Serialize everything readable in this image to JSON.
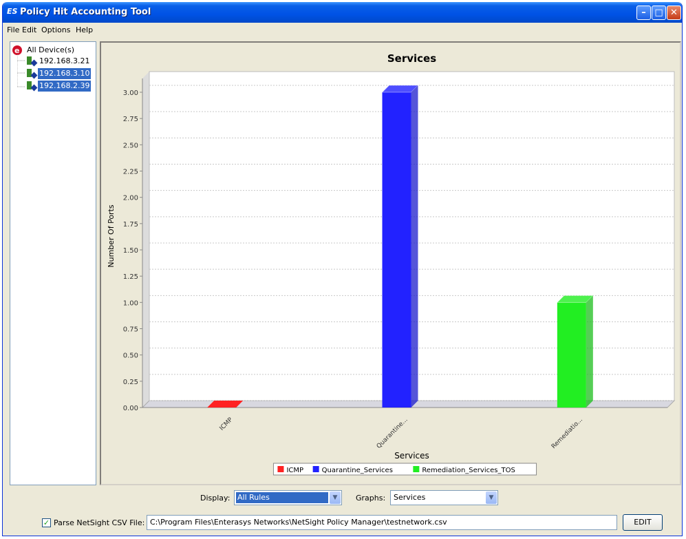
{
  "window": {
    "title": "Policy Hit Accounting Tool",
    "logo": "ES"
  },
  "menu": [
    "File",
    "Edit",
    "Options",
    "Help"
  ],
  "tree": {
    "root": "All Device(s)",
    "devices": [
      {
        "label": "192.168.3.21",
        "selected": false
      },
      {
        "label": "192.168.3.10",
        "selected": true
      },
      {
        "label": "192.168.2.39",
        "selected": true
      }
    ]
  },
  "chart_data": {
    "type": "bar",
    "title": "Services",
    "xlabel": "Services",
    "ylabel": "Number Of Ports",
    "ylim": [
      0,
      3.0
    ],
    "yticks": [
      "0.00",
      "0.25",
      "0.50",
      "0.75",
      "1.00",
      "1.25",
      "1.50",
      "1.75",
      "2.00",
      "2.25",
      "2.50",
      "2.75",
      "3.00"
    ],
    "categories": [
      "ICMP",
      "Quarantine...",
      "Remediatio..."
    ],
    "series": [
      {
        "name": "ICMP",
        "color": "#ff2222",
        "values": [
          0,
          null,
          null
        ]
      },
      {
        "name": "Quarantine_Services",
        "color": "#2222ff",
        "values": [
          null,
          3,
          null
        ]
      },
      {
        "name": "Remediation_Services_TOS",
        "color": "#22ee22",
        "values": [
          null,
          null,
          1
        ]
      }
    ],
    "grid": true,
    "legend": "bottom"
  },
  "controls": {
    "display_label": "Display:",
    "display_value": "All Rules",
    "graphs_label": "Graphs:",
    "graphs_value": "Services",
    "parse_checked": true,
    "parse_label": "Parse NetSight CSV File:",
    "csv_path": "C:\\Program Files\\Enterasys Networks\\NetSight Policy Manager\\testnetwork.csv",
    "edit_label": "EDIT"
  },
  "colors": {
    "titlebar": "#0052e5",
    "selection": "#316ac5"
  }
}
